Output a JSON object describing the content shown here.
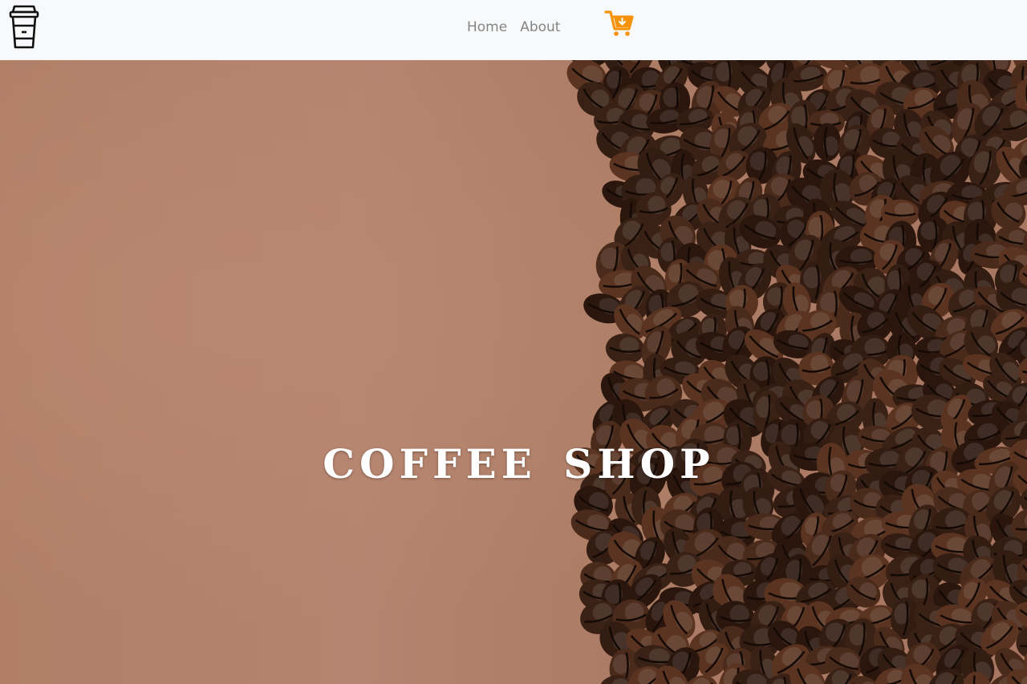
{
  "navbar": {
    "brand_icon": "coffee-cup-icon",
    "links": [
      {
        "label": "Home"
      },
      {
        "label": "About"
      }
    ],
    "cart_icon": "cart-download-icon",
    "cart_color": "#f5930c"
  },
  "hero": {
    "title": "COFFEE SHOP",
    "background_color": "#b07f66",
    "bean_color": "#3a2116"
  }
}
